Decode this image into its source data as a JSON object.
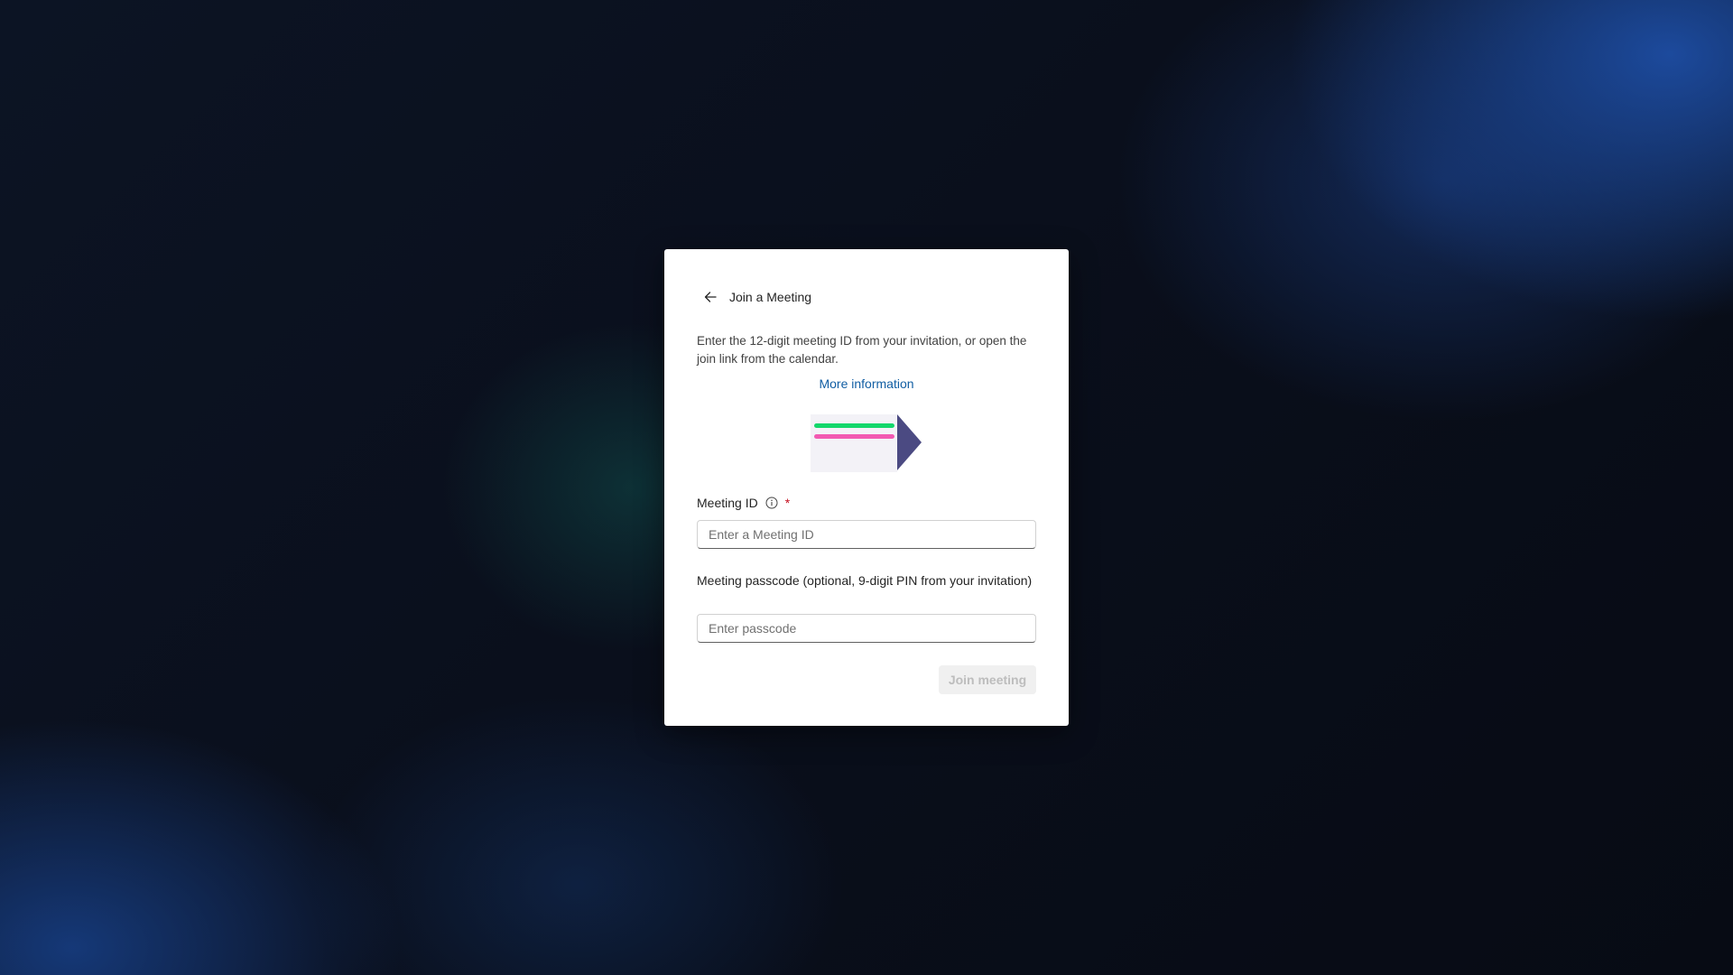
{
  "dialog": {
    "title": "Join a Meeting",
    "description": "Enter the 12-digit meeting ID from your invitation, or open the join link from the calendar.",
    "more_info_link": "More information",
    "meeting_id": {
      "label": "Meeting ID",
      "required_marker": "*",
      "placeholder": "Enter a Meeting ID",
      "value": ""
    },
    "passcode": {
      "label": "Meeting passcode (optional, 9-digit PIN from your invitation)",
      "placeholder": "Enter passcode",
      "value": ""
    },
    "join_button": {
      "label": "Join meeting",
      "state": "disabled"
    }
  },
  "icons": {
    "back": "arrow-left-icon",
    "info": "info-icon"
  },
  "colors": {
    "link": "#115ea3",
    "required": "#c50f1f",
    "illustration_green": "#13d76b",
    "illustration_pink": "#f25ab2",
    "illustration_arrow": "#4b4a82"
  }
}
